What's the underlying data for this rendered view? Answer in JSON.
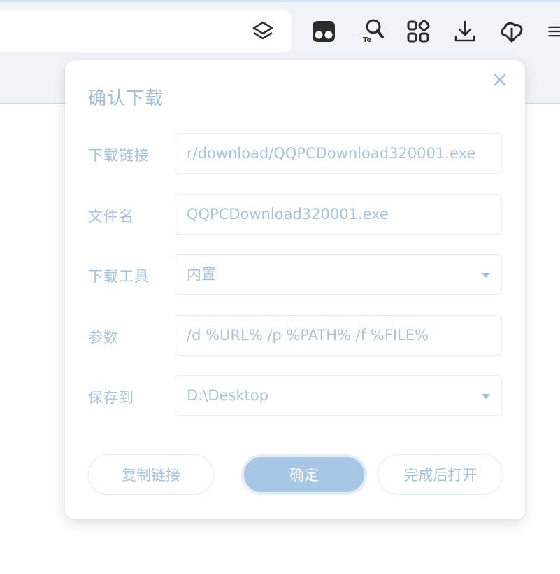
{
  "dialog": {
    "title": "确认下载",
    "fields": {
      "link": {
        "label": "下载链接",
        "value": "r/download/QQPCDownload320001.exe"
      },
      "filename": {
        "label": "文件名",
        "value": "QQPCDownload320001.exe"
      },
      "tool": {
        "label": "下载工具",
        "value": "内置"
      },
      "params": {
        "label": "参数",
        "value": "/d %URL% /p %PATH% /f %FILE%"
      },
      "save_to": {
        "label": "保存到",
        "value": "D:\\Desktop"
      }
    },
    "buttons": {
      "copy_link": "复制链接",
      "confirm": "确定",
      "open_after": "完成后打开"
    }
  },
  "icons": [
    "sidebar-icon",
    "tampermonkey-icon",
    "translate-icon",
    "apps-icon",
    "download-icon",
    "cloud-download-icon",
    "menu-icon"
  ],
  "colors": {
    "accent": "#a8c7e6",
    "text": "#a6c3e0",
    "title": "#9fc0e0"
  }
}
